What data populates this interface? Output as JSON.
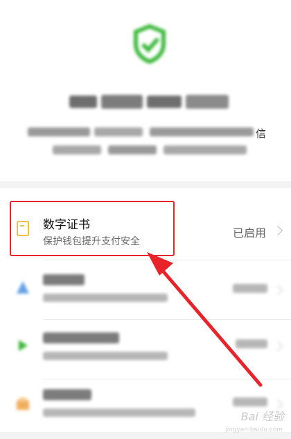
{
  "header": {
    "description_tail": "信"
  },
  "digital_certificate": {
    "title": "数字证书",
    "subtitle": "保护钱包提升支付安全",
    "status": "已启用"
  },
  "watermark": {
    "text": "Bai 经验",
    "sub": "jingyan.baidu.com"
  },
  "colors": {
    "accent_red": "#e8232a",
    "wechat_green": "#1aad19",
    "cert_icon_yellow": "#f0b92a"
  }
}
